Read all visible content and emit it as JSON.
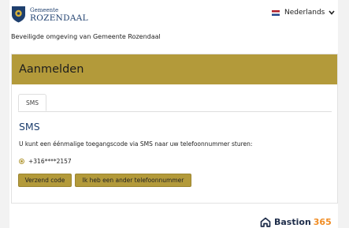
{
  "header": {
    "logo_small": "Gemeente",
    "logo_big": "ROZENDAAL",
    "language": "Nederlands"
  },
  "secure_note": "Beveiligde omgeving van Gemeente Rozendaal",
  "card": {
    "title": "Aanmelden",
    "tab_label": "SMS",
    "sms_title": "SMS",
    "description": "U kunt een éénmalige toegangscode via SMS naar uw telefoonnummer sturen:",
    "phone": "+316****2157",
    "send_button": "Verzend code",
    "other_button": "Ik heb een ander telefoonnummer"
  },
  "footer": {
    "brand": "Bastion",
    "brand_number": "365"
  },
  "colors": {
    "accent": "#b39a3a",
    "title_blue": "#1e3f6e",
    "brand_orange": "#f08c23"
  },
  "icons": {
    "logo": "municipality-crest-icon",
    "language_flag": "netherlands-flag-icon",
    "dropdown": "chevron-down-icon",
    "footer": "bastion-house-icon"
  }
}
